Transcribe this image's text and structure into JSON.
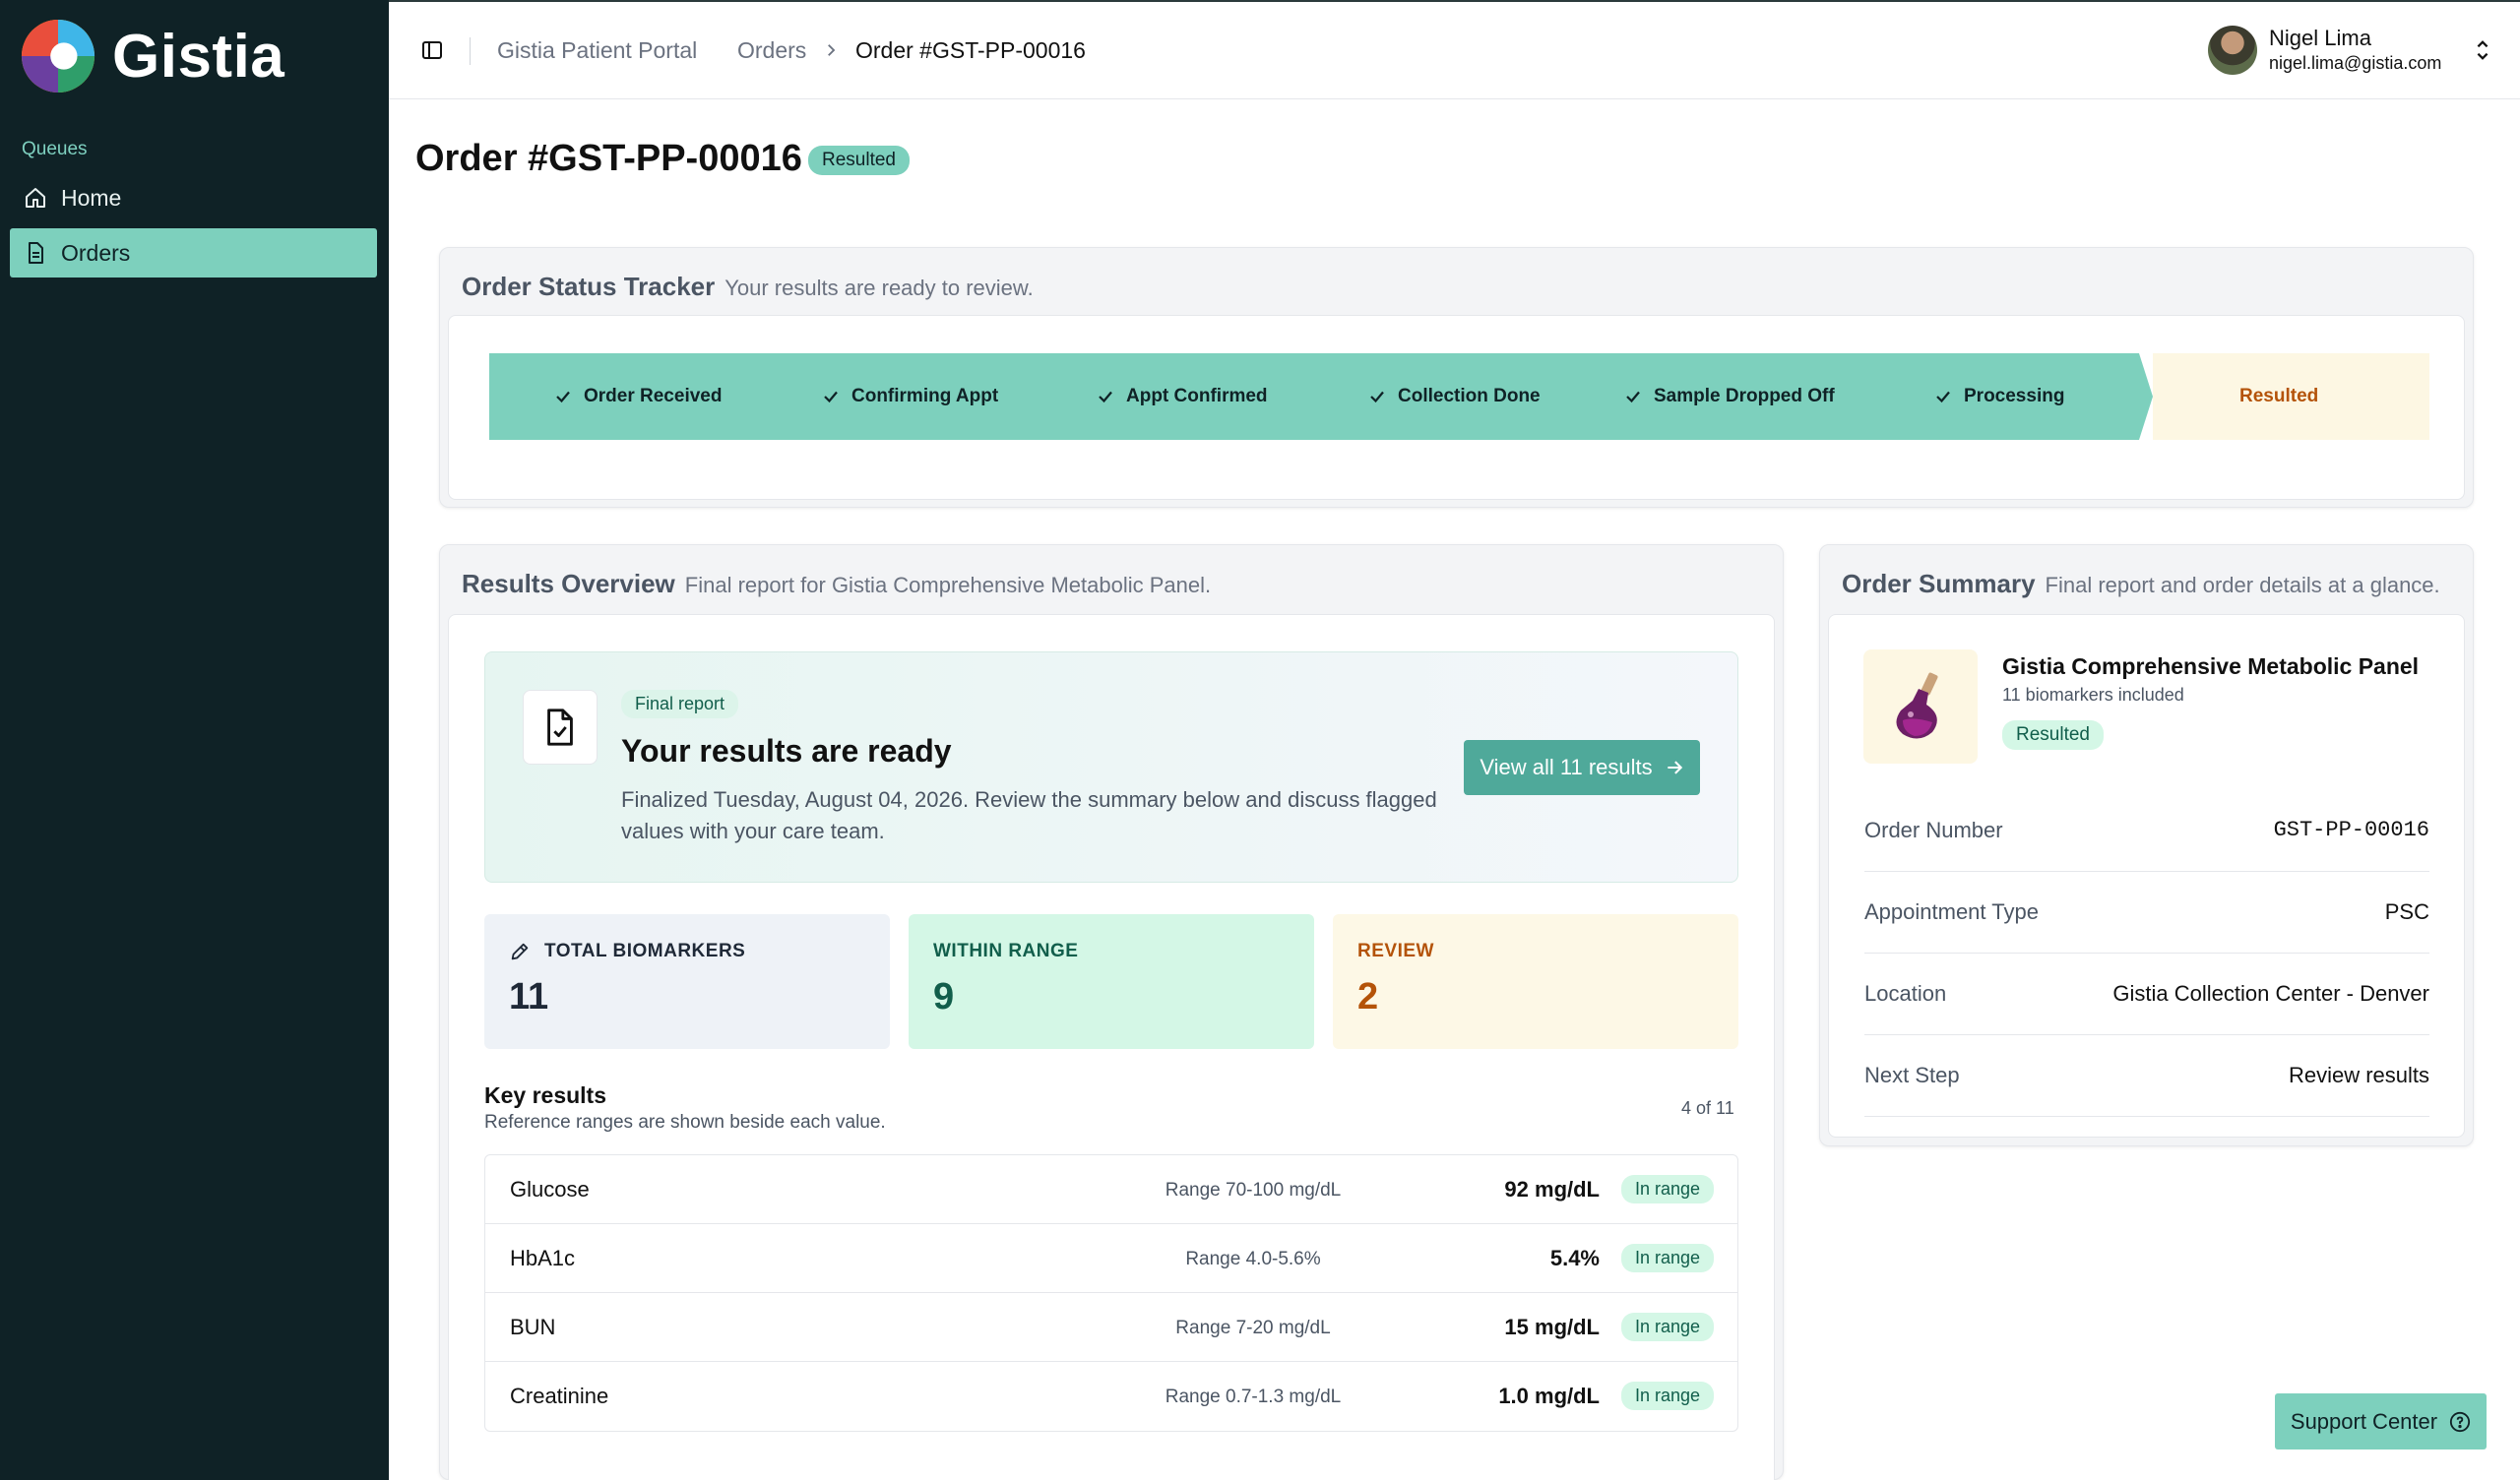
{
  "app": {
    "brand_name": "Gistia",
    "colors": {
      "sidebar": "#0f2226",
      "accent": "#7dd0bd",
      "accent_dark": "#4fa99a",
      "review": "#b45309"
    }
  },
  "sidebar": {
    "heading": "Queues",
    "items": [
      {
        "label": "Home",
        "icon": "home-icon",
        "active": false
      },
      {
        "label": "Orders",
        "icon": "document-icon",
        "active": true
      }
    ]
  },
  "topbar": {
    "breadcrumb": [
      "Gistia Patient Portal",
      "Orders",
      "Order #GST-PP-00016"
    ],
    "user": {
      "name": "Nigel Lima",
      "email": "nigel.lima@gistia.com"
    }
  },
  "page": {
    "title": "Order #GST-PP-00016",
    "status_badge": "Resulted"
  },
  "tracker": {
    "title": "Order Status Tracker",
    "subtitle": "Your results are ready to review.",
    "steps": [
      {
        "label": "Order Received",
        "state": "done"
      },
      {
        "label": "Confirming Appt",
        "state": "done"
      },
      {
        "label": "Appt Confirmed",
        "state": "done"
      },
      {
        "label": "Collection Done",
        "state": "done"
      },
      {
        "label": "Sample Dropped Off",
        "state": "done"
      },
      {
        "label": "Processing",
        "state": "done"
      },
      {
        "label": "Resulted",
        "state": "current"
      }
    ]
  },
  "results": {
    "title": "Results Overview",
    "subtitle": "Final report for Gistia Comprehensive Metabolic Panel.",
    "hero": {
      "pill": "Final report",
      "title": "Your results are ready",
      "description": "Finalized Tuesday, August 04, 2026. Review the summary below and discuss flagged values with your care team.",
      "button_label": "View all 11 results"
    },
    "stats": {
      "total_label": "TOTAL BIOMARKERS",
      "total_value": "11",
      "within_label": "WITHIN RANGE",
      "within_value": "9",
      "review_label": "REVIEW",
      "review_value": "2"
    },
    "key": {
      "title": "Key results",
      "subtitle": "Reference ranges are shown beside each value.",
      "count": "4 of 11",
      "rows": [
        {
          "name": "Glucose",
          "range": "Range 70-100 mg/dL",
          "value": "92 mg/dL",
          "status": "In range"
        },
        {
          "name": "HbA1c",
          "range": "Range 4.0-5.6%",
          "value": "5.4%",
          "status": "In range"
        },
        {
          "name": "BUN",
          "range": "Range 7-20 mg/dL",
          "value": "15 mg/dL",
          "status": "In range"
        },
        {
          "name": "Creatinine",
          "range": "Range 0.7-1.3 mg/dL",
          "value": "1.0 mg/dL",
          "status": "In range"
        }
      ]
    }
  },
  "summary": {
    "title": "Order Summary",
    "subtitle": "Final report and order details at a glance.",
    "product": {
      "name": "Gistia Comprehensive Metabolic Panel",
      "sub": "11 biomarkers included",
      "badge": "Resulted",
      "icon": "flask-icon"
    },
    "rows": [
      {
        "label": "Order Number",
        "value": "GST-PP-00016"
      },
      {
        "label": "Appointment Type",
        "value": "PSC"
      },
      {
        "label": "Location",
        "value": "Gistia Collection Center - Denver"
      },
      {
        "label": "Next Step",
        "value": "Review results"
      }
    ]
  },
  "support": {
    "label": "Support Center"
  }
}
